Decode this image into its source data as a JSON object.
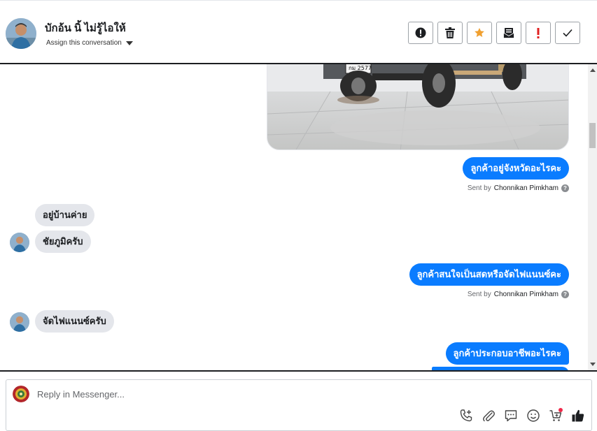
{
  "header": {
    "contact_name": "บักอ้น นิ้ ไม่รู้ไอให้",
    "assign_label": "Assign this conversation",
    "actions": [
      {
        "name": "report-icon",
        "color": "#1c1e21"
      },
      {
        "name": "trash-icon",
        "color": "#1c1e21"
      },
      {
        "name": "star-icon",
        "color": "#f0a030"
      },
      {
        "name": "mark-unread-icon",
        "color": "#1c1e21"
      },
      {
        "name": "follow-up-icon",
        "color": "#e02020"
      },
      {
        "name": "done-check-icon",
        "color": "#1c1e21"
      }
    ]
  },
  "thread": {
    "photo": {
      "plate": "กม 2577"
    },
    "messages": [
      {
        "direction": "out",
        "text": "ลูกค้าอยู่จังหวัดอะไรคะ",
        "sent_by_prefix": "Sent by",
        "sent_by_name": "Chonnikan Pimkham"
      },
      {
        "direction": "in",
        "text": "อยู่บ้านค่าย"
      },
      {
        "direction": "in",
        "text": "ชัยภูมิครับ"
      },
      {
        "direction": "out",
        "text": "ลูกค้าสนใจเป็นสดหรือจัดไฟแนนซ์คะ",
        "sent_by_prefix": "Sent by",
        "sent_by_name": "Chonnikan Pimkham"
      },
      {
        "direction": "in",
        "text": "จัดไฟแนนซ์ครับ"
      },
      {
        "direction": "out",
        "text": "ลูกค้าประกอบอาชีพอะไรคะ"
      }
    ]
  },
  "composer": {
    "placeholder": "Reply in Messenger...",
    "tools": [
      "call-add-icon",
      "attachment-icon",
      "saved-reply-icon",
      "emoji-icon",
      "cart-icon",
      "thumbs-up-icon"
    ]
  },
  "colors": {
    "brand_blue": "#0a7cff",
    "incoming_bubble": "#e4e6eb"
  }
}
